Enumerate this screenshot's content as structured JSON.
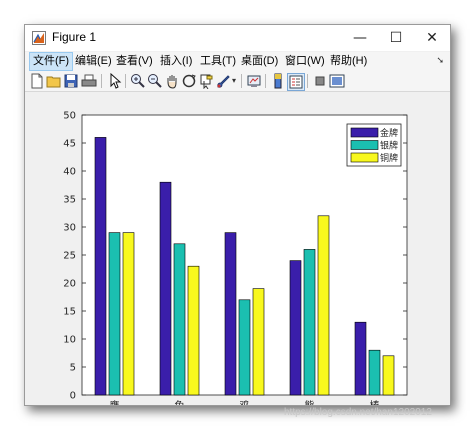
{
  "window": {
    "title": "Figure 1",
    "controls": {
      "minimize": "—",
      "maximize": "☐",
      "close": "✕"
    }
  },
  "menu": {
    "items": [
      {
        "label": "文件(F)",
        "active": true
      },
      {
        "label": "编辑(E)"
      },
      {
        "label": "查看(V)"
      },
      {
        "label": "插入(I)"
      },
      {
        "label": "工具(T)"
      },
      {
        "label": "桌面(D)"
      },
      {
        "label": "窗口(W)"
      },
      {
        "label": "帮助(H)"
      }
    ],
    "overflow_arrow": "➘"
  },
  "toolbar": {
    "icons": [
      "new-figure-icon",
      "open-file-icon",
      "save-icon",
      "print-icon",
      "pointer-icon",
      "zoom-in-icon",
      "zoom-out-icon",
      "pan-icon",
      "rotate-icon",
      "data-cursor-icon",
      "brush-icon",
      "link-plot-icon",
      "colorbar-icon",
      "legend-icon",
      "hide-plot-tools-icon",
      "show-plot-tools-icon"
    ]
  },
  "chart_data": {
    "type": "bar",
    "categories": [
      "鹰",
      "兔",
      "鸡",
      "熊",
      "棒"
    ],
    "series": [
      {
        "name": "金牌",
        "color": "#3a1eaa",
        "values": [
          46,
          38,
          29,
          24,
          13
        ]
      },
      {
        "name": "银牌",
        "color": "#1bbfb0",
        "values": [
          29,
          27,
          17,
          26,
          8
        ]
      },
      {
        "name": "铜牌",
        "color": "#f8f81e",
        "values": [
          29,
          23,
          19,
          32,
          7
        ]
      }
    ],
    "title": "",
    "xlabel": "",
    "ylabel": "",
    "ylim": [
      0,
      50
    ],
    "yticks": [
      "0",
      "5",
      "10",
      "15",
      "20",
      "25",
      "30",
      "35",
      "40",
      "45",
      "50"
    ],
    "grid": false,
    "legend_position": "top-right"
  },
  "watermark": "https://blog.csdn.net/han1202012"
}
